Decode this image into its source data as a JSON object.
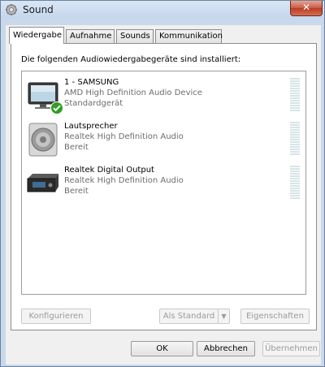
{
  "window": {
    "title": "Sound",
    "close_glyph": "✕",
    "title_icon": "speaker-gear-icon"
  },
  "tabs": [
    {
      "label": "Wiedergabe",
      "active": true
    },
    {
      "label": "Aufnahme",
      "active": false
    },
    {
      "label": "Sounds",
      "active": false
    },
    {
      "label": "Kommunikation",
      "active": false
    }
  ],
  "panel": {
    "heading": "Die folgenden Audiowiedergabegeräte sind installiert:"
  },
  "devices": [
    {
      "name": "1 - SAMSUNG",
      "description": "AMD High Definition Audio Device",
      "status": "Standardgerät",
      "icon": "monitor-icon",
      "default": true
    },
    {
      "name": "Lautsprecher",
      "description": "Realtek High Definition Audio",
      "status": "Bereit",
      "icon": "speaker-icon",
      "default": false
    },
    {
      "name": "Realtek Digital Output",
      "description": "Realtek High Definition Audio",
      "status": "Bereit",
      "icon": "digital-output-icon",
      "default": false
    }
  ],
  "panel_buttons": {
    "configure": "Konfigurieren",
    "set_default": "Als Standard",
    "set_default_arrow": "▼",
    "properties": "Eigenschaften"
  },
  "dialog_buttons": {
    "ok": "OK",
    "cancel": "Abbrechen",
    "apply": "Übernehmen"
  },
  "colors": {
    "window_frame": "#c9d8ea",
    "close_button": "#c75a44",
    "default_check": "#2f9e22",
    "meter_bar": "#d7e4e7"
  }
}
